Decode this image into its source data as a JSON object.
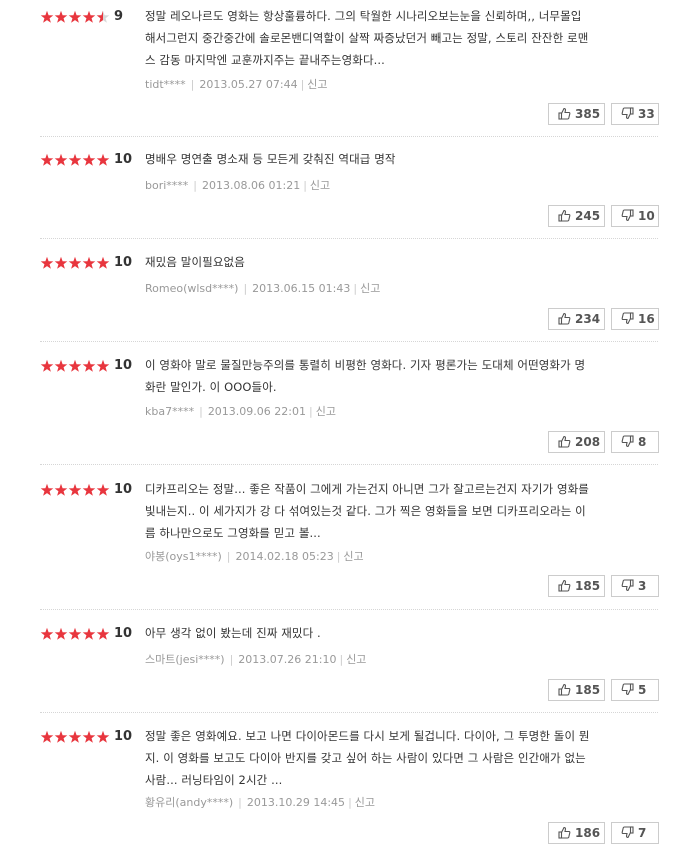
{
  "colors": {
    "star_full": "#e8363e",
    "star_empty": "#d8d8d8",
    "text": "#333333",
    "meta": "#999999"
  },
  "reviews": [
    {
      "stars": 4.5,
      "score": "9",
      "lines": [
        "정말 레오나르도 영화는 항상훌륭하다. 그의 탁월한 시나리오보는눈을 신뢰하며,, 너무몰입",
        "해서그런지 중간중간에 솔로몬밴디역할이 살짝 짜증났던거 빼고는 정말, 스토리 잔잔한 로맨",
        "스 감동 마지막엔 교훈까지주는 끝내주는영화다..."
      ],
      "user": "tidt****",
      "date": "2013.05.27 07:44",
      "report": "신고",
      "likes": "385",
      "dislikes": "33"
    },
    {
      "stars": 5,
      "score": "10",
      "lines": [
        "명배우 명연출 명소재 등 모든게 갖춰진 역대급 명작"
      ],
      "user": "bori****",
      "date": "2013.08.06 01:21",
      "report": "신고",
      "likes": "245",
      "dislikes": "10"
    },
    {
      "stars": 5,
      "score": "10",
      "lines": [
        "재밌음 말이필요없음"
      ],
      "user": "Romeo(wlsd****)",
      "date": "2013.06.15 01:43",
      "report": "신고",
      "likes": "234",
      "dislikes": "16"
    },
    {
      "stars": 5,
      "score": "10",
      "lines": [
        "이 영화야 말로 물질만능주의를 통렬히 비평한 영화다. 기자 평론가는 도대체 어떤영화가 명",
        "화란 말인가. 이 OOO들아."
      ],
      "user": "kba7****",
      "date": "2013.09.06 22:01",
      "report": "신고",
      "likes": "208",
      "dislikes": "8"
    },
    {
      "stars": 5,
      "score": "10",
      "lines": [
        "디카프리오는 정말... 좋은 작품이 그에게 가는건지 아니면 그가 잘고르는건지 자기가 영화를",
        "빛내는지.. 이 세가지가 강 다 섞여있는것 같다. 그가 찍은 영화들을 보면 디카프리오라는 이",
        "름 하나만으로도 그영화를 믿고 볼..."
      ],
      "user": "야봉(oys1****)",
      "date": "2014.02.18 05:23",
      "report": "신고",
      "likes": "185",
      "dislikes": "3"
    },
    {
      "stars": 5,
      "score": "10",
      "lines": [
        "아무 생각 없이 봤는데 진짜 재밌다 ."
      ],
      "user": "스마트(jesi****)",
      "date": "2013.07.26 21:10",
      "report": "신고",
      "likes": "185",
      "dislikes": "5"
    },
    {
      "stars": 5,
      "score": "10",
      "lines": [
        "정말 좋은 영화예요. 보고 나면 다이아몬드를 다시 보게 될겁니다. 다이아, 그 투명한 돌이 뭔",
        "지. 이 영화를 보고도 다이아 반지를 갖고 싶어 하는 사람이 있다면 그 사람은 인간애가 없는",
        "사람... 러닝타임이 2시간 ..."
      ],
      "user": "황유리(andy****)",
      "date": "2013.10.29 14:45",
      "report": "신고",
      "likes": "186",
      "dislikes": "7"
    }
  ]
}
